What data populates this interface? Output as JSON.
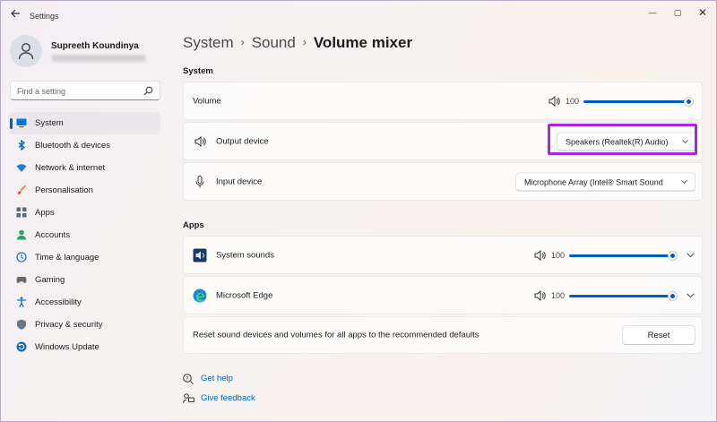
{
  "window": {
    "title": "Settings",
    "controls": {
      "minimize": "—",
      "maximize": "▢",
      "close": "✕"
    }
  },
  "profile": {
    "name": "Supreeth Koundinya"
  },
  "search": {
    "placeholder": "Find a setting",
    "icon": "search-icon"
  },
  "sidebar": {
    "items": [
      {
        "label": "System",
        "icon": "monitor-icon",
        "active": true
      },
      {
        "label": "Bluetooth & devices",
        "icon": "bluetooth-icon"
      },
      {
        "label": "Network & internet",
        "icon": "wifi-icon"
      },
      {
        "label": "Personalisation",
        "icon": "brush-icon"
      },
      {
        "label": "Apps",
        "icon": "apps-grid-icon"
      },
      {
        "label": "Accounts",
        "icon": "person-icon"
      },
      {
        "label": "Time & language",
        "icon": "globe-clock-icon"
      },
      {
        "label": "Gaming",
        "icon": "gamepad-icon"
      },
      {
        "label": "Accessibility",
        "icon": "accessibility-icon"
      },
      {
        "label": "Privacy & security",
        "icon": "shield-icon"
      },
      {
        "label": "Windows Update",
        "icon": "update-icon"
      }
    ]
  },
  "breadcrumb": {
    "items": [
      "System",
      "Sound"
    ],
    "current": "Volume mixer",
    "separator": "›"
  },
  "system_section": {
    "title": "System",
    "volume": {
      "label": "Volume",
      "value": "100",
      "level": 100
    },
    "output": {
      "label": "Output device",
      "selected": "Speakers (Realtek(R) Audio)"
    },
    "input": {
      "label": "Input device",
      "selected": "Microphone Array (Intel® Smart Sound"
    }
  },
  "apps_section": {
    "title": "Apps",
    "apps": [
      {
        "name": "System sounds",
        "volume": "100",
        "level": 100,
        "icon": "system-sounds-icon"
      },
      {
        "name": "Microsoft Edge",
        "volume": "100",
        "level": 100,
        "icon": "edge-icon"
      }
    ]
  },
  "reset": {
    "text": "Reset sound devices and volumes for all apps to the recommended defaults",
    "button": "Reset"
  },
  "links": {
    "help": "Get help",
    "feedback": "Give feedback"
  },
  "colors": {
    "accent": "#005fb8",
    "highlight": "#a62ad8",
    "link": "#005fb8"
  }
}
